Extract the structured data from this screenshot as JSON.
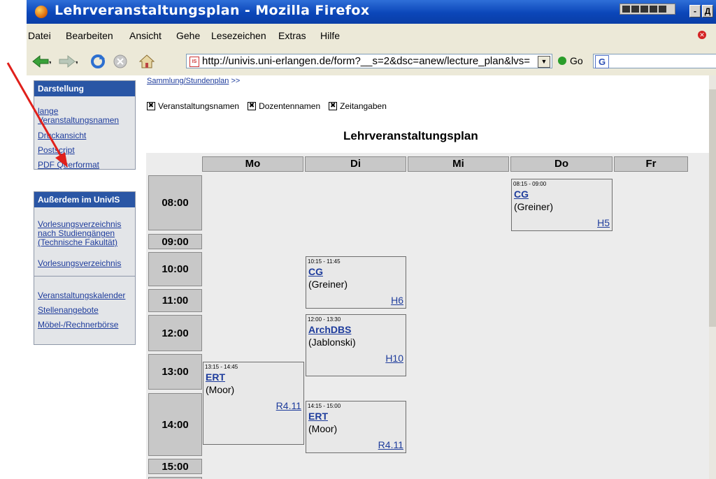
{
  "window": {
    "title": "Lehrveranstaltungsplan - Mozilla Firefox",
    "buttons": [
      "-",
      "Д"
    ]
  },
  "menu": [
    "Datei",
    "Bearbeiten",
    "Ansicht",
    "Gehe",
    "Lesezeichen",
    "Extras",
    "Hilfe"
  ],
  "toolbar": {
    "url": "http://univis.uni-erlangen.de/form?__s=2&dsc=anew/lecture_plan&lvs=",
    "go_label": "Go",
    "search_logo": "G"
  },
  "sidebar": {
    "darstellung": {
      "header": "Darstellung",
      "links": [
        "lange Veranstaltungsnamen",
        "Druckansicht",
        "Postscript",
        "PDF Querformat"
      ]
    },
    "ausserdem": {
      "header": "Außerdem im UnivIS",
      "links": [
        "Vorlesungsverzeichnis nach Studiengängen (Technische Fakultät)",
        "Vorlesungsverzeichnis"
      ]
    },
    "extra_links": [
      "Veranstaltungskalender",
      "Stellenangebote",
      "Möbel-/Rechnerbörse"
    ]
  },
  "breadcrumb": {
    "link": "Sammlung/Stundenplan",
    "suffix": ">>"
  },
  "options": [
    "Veranstaltungsnamen",
    "Dozentennamen",
    "Zeitangaben"
  ],
  "plan": {
    "title": "Lehrveranstaltungsplan",
    "days": [
      "Mo",
      "Di",
      "Mi",
      "Do",
      "Fr"
    ],
    "times": [
      "08:00",
      "09:00",
      "10:00",
      "11:00",
      "12:00",
      "13:00",
      "14:00",
      "15:00"
    ],
    "events": [
      {
        "time": "08:15 - 09:00",
        "name": "CG",
        "lecturer": "(Greiner)",
        "room": "H5"
      },
      {
        "time": "10:15 - 11:45",
        "name": "CG",
        "lecturer": "(Greiner)",
        "room": "H6"
      },
      {
        "time": "12:00 - 13:30",
        "name": "ArchDBS",
        "lecturer": "(Jablonski)",
        "room": "H10"
      },
      {
        "time": "13:15 - 14:45",
        "name": "ERT",
        "lecturer": "(Moor)",
        "room": "R4.11"
      },
      {
        "time": "14:15 - 15:00",
        "name": "ERT",
        "lecturer": "(Moor)",
        "room": "R4.11"
      }
    ]
  },
  "colors": {
    "titlebar": "#0b46b9",
    "panel_header": "#2a56a5",
    "link": "#1e3c9c",
    "annotation_arrow": "#e0201b"
  }
}
